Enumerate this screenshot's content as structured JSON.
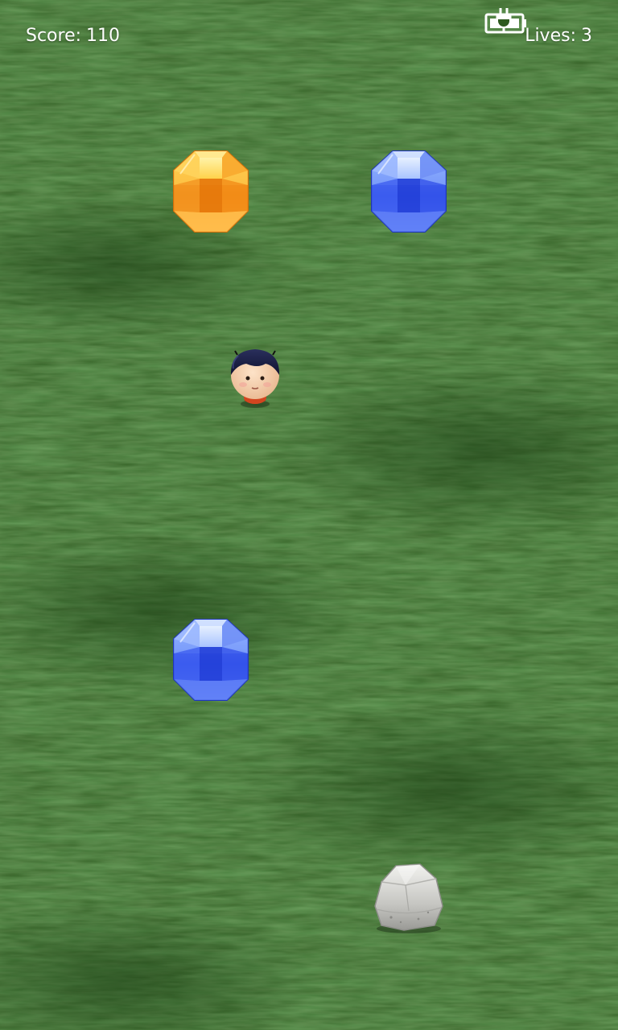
{
  "hud": {
    "score_label": "Score:",
    "score_value": "110",
    "lives_label": "Lives:",
    "lives_value": "3",
    "battery_icon": "battery-charging-icon"
  },
  "field": {
    "background": "grass",
    "grass_color": "#2f5a20"
  },
  "objects": [
    {
      "kind": "gem",
      "color": "orange",
      "hex": "#f59a1e"
    },
    {
      "kind": "gem",
      "color": "blue",
      "hex": "#3a63f0"
    },
    {
      "kind": "player",
      "character": "boy-head"
    },
    {
      "kind": "gem",
      "color": "blue",
      "hex": "#3a63f0"
    },
    {
      "kind": "rock",
      "color": "gray",
      "hex": "#c9c9c6"
    }
  ]
}
